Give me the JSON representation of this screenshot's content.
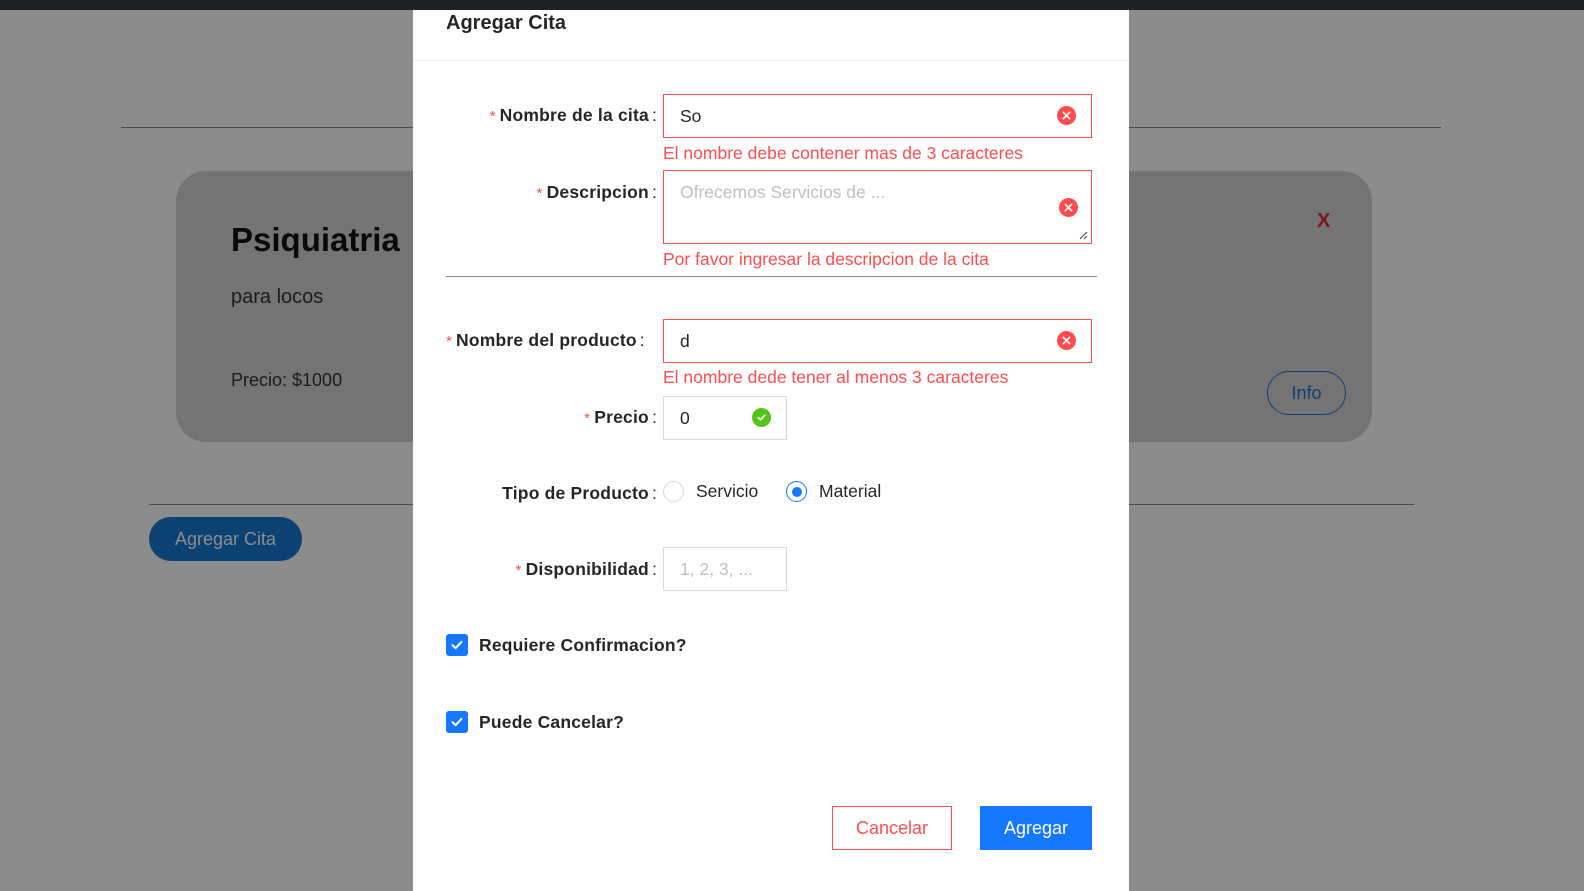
{
  "background": {
    "card": {
      "title": "Psiquiatria",
      "description": "para locos",
      "price": "Precio: $1000",
      "close_label": "X",
      "info_label": "Info"
    },
    "add_button_label": "Agregar Cita"
  },
  "modal": {
    "title": "Agregar Cita",
    "colon": ":",
    "required_mark": "*",
    "fields": {
      "appointment_name": {
        "label": "Nombre de la cita",
        "value": "So",
        "error": "El nombre debe contener mas de 3 caracteres"
      },
      "description": {
        "label": "Descripcion",
        "placeholder": "Ofrecemos Servicios de ...",
        "error": "Por favor ingresar la descripcion de la cita"
      },
      "product_name": {
        "label": "Nombre del producto",
        "value": "d",
        "error": "El nombre dede tener al menos 3 caracteres"
      },
      "price": {
        "label": "Precio",
        "value": "0"
      },
      "product_type": {
        "label": "Tipo de Producto",
        "options": [
          "Servicio",
          "Material"
        ],
        "selected": "Material"
      },
      "availability": {
        "label": "Disponibilidad",
        "placeholder": "1, 2, 3, ..."
      }
    },
    "checkboxes": {
      "requires_confirmation": {
        "label": "Requiere Confirmacion?",
        "checked": true
      },
      "can_cancel": {
        "label": "Puede Cancelar?",
        "checked": true
      }
    },
    "buttons": {
      "cancel": "Cancelar",
      "submit": "Agregar"
    }
  },
  "colors": {
    "primary": "#1677ff",
    "error": "#ff4d4f",
    "success": "#52c41a",
    "overlay": "rgba(0,0,0,0.45)"
  }
}
